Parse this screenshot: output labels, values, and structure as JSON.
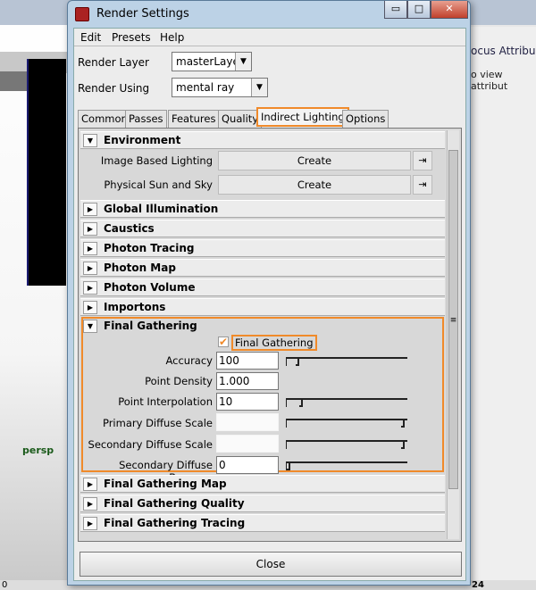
{
  "window": {
    "title": "Render Settings",
    "minimize": "▭",
    "maximize": "□",
    "close": "✕"
  },
  "menu": [
    "Edit",
    "Presets",
    "Help"
  ],
  "render_layer": {
    "label": "Render Layer",
    "value": "masterLayer"
  },
  "render_using": {
    "label": "Render Using",
    "value": "mental ray"
  },
  "tabs": [
    "Common",
    "Passes",
    "Features",
    "Quality",
    "Indirect Lighting",
    "Options"
  ],
  "active_tab": "Indirect Lighting",
  "environment": {
    "title": "Environment",
    "rows": [
      {
        "label": "Image Based Lighting",
        "button": "Create"
      },
      {
        "label": "Physical Sun and Sky",
        "button": "Create"
      }
    ]
  },
  "collapsed_sections": [
    "Global Illumination",
    "Caustics",
    "Photon Tracing",
    "Photon Map",
    "Photon Volume",
    "Importons"
  ],
  "final_gathering": {
    "title": "Final Gathering",
    "checkbox_label": "Final Gathering",
    "checked": true,
    "fields": [
      {
        "label": "Accuracy",
        "value": "100",
        "slider": 0.08
      },
      {
        "label": "Point Density",
        "value": "1.000"
      },
      {
        "label": "Point Interpolation",
        "value": "10",
        "slider": 0.1
      },
      {
        "label": "Primary Diffuse Scale",
        "value": "",
        "slider": 1.0
      },
      {
        "label": "Secondary Diffuse Scale",
        "value": "",
        "slider": 1.0
      },
      {
        "label": "Secondary Diffuse Bounces",
        "value": "0",
        "slider": 0.0
      }
    ]
  },
  "after_sections": [
    "Final Gathering Map",
    "Final Gathering Quality",
    "Final Gathering Tracing"
  ],
  "close_label": "Close",
  "background": {
    "viewport_label": "persp",
    "right_tabs": "ocus  Attribu",
    "right_hint": "o view attribut",
    "timeline_left": "0",
    "timeline_right": "24"
  },
  "accent_color": "#f08a2a"
}
